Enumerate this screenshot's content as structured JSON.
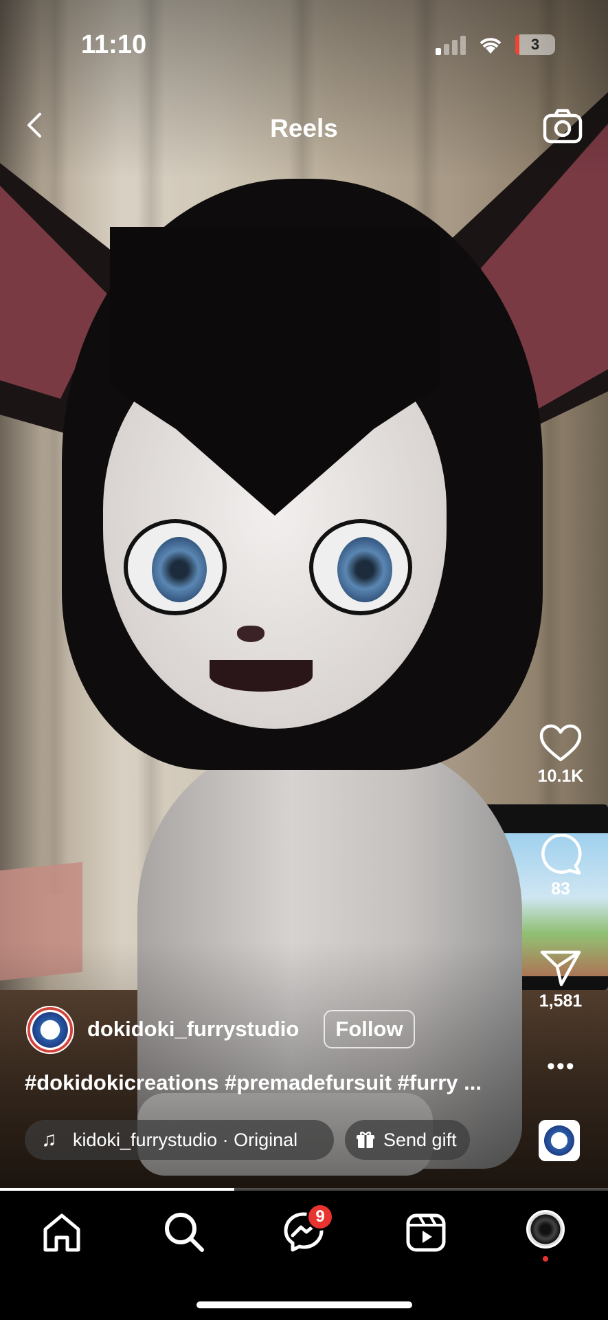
{
  "status_bar": {
    "time": "11:10",
    "battery": "3"
  },
  "header": {
    "title": "Reels"
  },
  "rail": {
    "likes": "10.1K",
    "comments": "83",
    "shares": "1,581"
  },
  "post": {
    "username": "dokidoki_furrystudio",
    "follow_label": "Follow",
    "caption": "#dokidokicreations #premadefursuit #furry ...",
    "audio": "kidoki_furrystudio · Original",
    "gift_label": "Send gift",
    "progress": 0.385
  },
  "nav": {
    "messages_badge": "9"
  },
  "colors": {
    "badge": "#e8332f",
    "background": "#000000"
  }
}
